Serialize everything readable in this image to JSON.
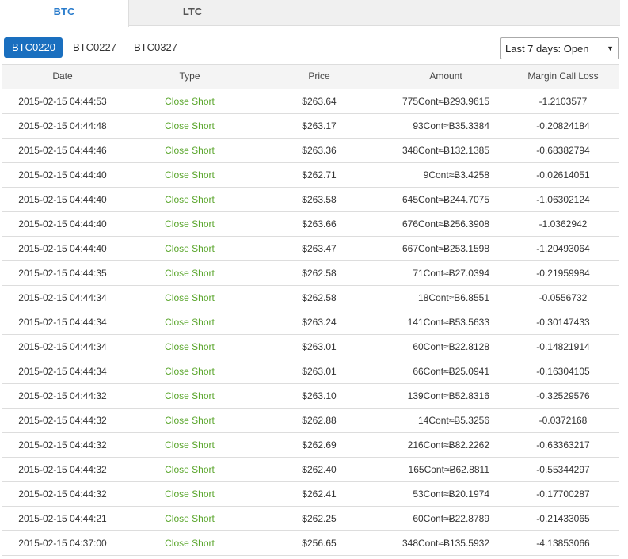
{
  "top_tabs": [
    {
      "label": "BTC",
      "active": true
    },
    {
      "label": "LTC",
      "active": false
    }
  ],
  "contract_tabs": [
    {
      "label": "BTC0220",
      "active": true
    },
    {
      "label": "BTC0227",
      "active": false
    },
    {
      "label": "BTC0327",
      "active": false
    }
  ],
  "filter": {
    "value": "Last 7 days: Open"
  },
  "colors": {
    "accent": "#1a6fbf",
    "tab_active_text": "#2a7ccc",
    "type_text": "#5aa62c"
  },
  "table": {
    "headers": {
      "date": "Date",
      "type": "Type",
      "price": "Price",
      "amount": "Amount",
      "loss": "Margin Call Loss"
    },
    "rows": [
      {
        "date": "2015-02-15 04:44:53",
        "type": "Close Short",
        "price": "$263.64",
        "amount": "775Cont≈Ƀ293.9615",
        "loss": "-1.2103577"
      },
      {
        "date": "2015-02-15 04:44:48",
        "type": "Close Short",
        "price": "$263.17",
        "amount": "93Cont≈Ƀ35.3384",
        "loss": "-0.20824184"
      },
      {
        "date": "2015-02-15 04:44:46",
        "type": "Close Short",
        "price": "$263.36",
        "amount": "348Cont≈Ƀ132.1385",
        "loss": "-0.68382794"
      },
      {
        "date": "2015-02-15 04:44:40",
        "type": "Close Short",
        "price": "$262.71",
        "amount": "9Cont≈Ƀ3.4258",
        "loss": "-0.02614051"
      },
      {
        "date": "2015-02-15 04:44:40",
        "type": "Close Short",
        "price": "$263.58",
        "amount": "645Cont≈Ƀ244.7075",
        "loss": "-1.06302124"
      },
      {
        "date": "2015-02-15 04:44:40",
        "type": "Close Short",
        "price": "$263.66",
        "amount": "676Cont≈Ƀ256.3908",
        "loss": "-1.0362942"
      },
      {
        "date": "2015-02-15 04:44:40",
        "type": "Close Short",
        "price": "$263.47",
        "amount": "667Cont≈Ƀ253.1598",
        "loss": "-1.20493064"
      },
      {
        "date": "2015-02-15 04:44:35",
        "type": "Close Short",
        "price": "$262.58",
        "amount": "71Cont≈Ƀ27.0394",
        "loss": "-0.21959984"
      },
      {
        "date": "2015-02-15 04:44:34",
        "type": "Close Short",
        "price": "$262.58",
        "amount": "18Cont≈Ƀ6.8551",
        "loss": "-0.0556732"
      },
      {
        "date": "2015-02-15 04:44:34",
        "type": "Close Short",
        "price": "$263.24",
        "amount": "141Cont≈Ƀ53.5633",
        "loss": "-0.30147433"
      },
      {
        "date": "2015-02-15 04:44:34",
        "type": "Close Short",
        "price": "$263.01",
        "amount": "60Cont≈Ƀ22.8128",
        "loss": "-0.14821914"
      },
      {
        "date": "2015-02-15 04:44:34",
        "type": "Close Short",
        "price": "$263.01",
        "amount": "66Cont≈Ƀ25.0941",
        "loss": "-0.16304105"
      },
      {
        "date": "2015-02-15 04:44:32",
        "type": "Close Short",
        "price": "$263.10",
        "amount": "139Cont≈Ƀ52.8316",
        "loss": "-0.32529576"
      },
      {
        "date": "2015-02-15 04:44:32",
        "type": "Close Short",
        "price": "$262.88",
        "amount": "14Cont≈Ƀ5.3256",
        "loss": "-0.0372168"
      },
      {
        "date": "2015-02-15 04:44:32",
        "type": "Close Short",
        "price": "$262.69",
        "amount": "216Cont≈Ƀ82.2262",
        "loss": "-0.63363217"
      },
      {
        "date": "2015-02-15 04:44:32",
        "type": "Close Short",
        "price": "$262.40",
        "amount": "165Cont≈Ƀ62.8811",
        "loss": "-0.55344297"
      },
      {
        "date": "2015-02-15 04:44:32",
        "type": "Close Short",
        "price": "$262.41",
        "amount": "53Cont≈Ƀ20.1974",
        "loss": "-0.17700287"
      },
      {
        "date": "2015-02-15 04:44:21",
        "type": "Close Short",
        "price": "$262.25",
        "amount": "60Cont≈Ƀ22.8789",
        "loss": "-0.21433065"
      },
      {
        "date": "2015-02-15 04:37:00",
        "type": "Close Short",
        "price": "$256.65",
        "amount": "348Cont≈Ƀ135.5932",
        "loss": "-4.13853066"
      }
    ]
  }
}
